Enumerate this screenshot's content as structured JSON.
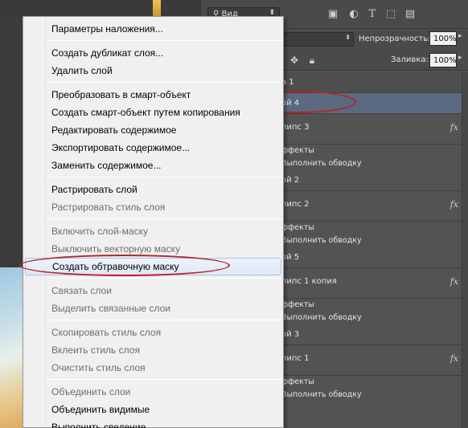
{
  "layers_panel": {
    "kind_filter": "Вид",
    "opacity_label": "Непрозрачность:",
    "opacity_value": "100%",
    "fill_label": "Заливка:",
    "fill_value": "100%",
    "rows": [
      {
        "kind": "group",
        "name": "а 1"
      },
      {
        "kind": "layer",
        "name": "ой 4",
        "selected": true
      },
      {
        "kind": "shape",
        "name": "липс 3",
        "fx": "fx"
      },
      {
        "kind": "effect",
        "name": "ффекты"
      },
      {
        "kind": "effect",
        "name": "Выполнить обводку"
      },
      {
        "kind": "layer",
        "name": "ой 2"
      },
      {
        "kind": "shape",
        "name": "липс 2",
        "fx": "fx"
      },
      {
        "kind": "effect",
        "name": "ффекты"
      },
      {
        "kind": "effect",
        "name": "Выполнить обводку"
      },
      {
        "kind": "layer",
        "name": "ой 5"
      },
      {
        "kind": "shape",
        "name": "липс 1 копия",
        "fx": "fx"
      },
      {
        "kind": "effect",
        "name": "ффекты"
      },
      {
        "kind": "effect",
        "name": "Выполнить обводку"
      },
      {
        "kind": "layer",
        "name": "ой 3"
      },
      {
        "kind": "shape",
        "name": "липс 1",
        "fx": "fx"
      },
      {
        "kind": "effect",
        "name": "ффекты"
      },
      {
        "kind": "effect",
        "name": "Выполнить обводку"
      }
    ],
    "filter_icons": [
      "image-filter-icon",
      "adjustment-filter-icon",
      "text-filter-icon",
      "shape-filter-icon",
      "smart-object-filter-icon"
    ],
    "lock_icons": [
      "move-lock-icon",
      "lock-icon"
    ]
  },
  "context_menu": {
    "items": [
      {
        "label": "Параметры наложения...",
        "enabled": true
      },
      {
        "sep": true
      },
      {
        "label": "Создать дубликат слоя...",
        "enabled": true
      },
      {
        "label": "Удалить слой",
        "enabled": true
      },
      {
        "sep": true
      },
      {
        "label": "Преобразовать в смарт-объект",
        "enabled": true
      },
      {
        "label": "Создать смарт-объект путем копирования",
        "enabled": true
      },
      {
        "label": "Редактировать содержимое",
        "enabled": true
      },
      {
        "label": "Экспортировать содержимое...",
        "enabled": true
      },
      {
        "label": "Заменить содержимое...",
        "enabled": true
      },
      {
        "sep": true
      },
      {
        "label": "Растрировать слой",
        "enabled": true
      },
      {
        "label": "Растрировать стиль слоя",
        "enabled": false
      },
      {
        "sep": true
      },
      {
        "label": "Включить слой-маску",
        "enabled": false
      },
      {
        "label": "Выключить векторную маску",
        "enabled": false
      },
      {
        "label": "Создать обтравочную маску",
        "enabled": true,
        "highlighted": true
      },
      {
        "sep": true
      },
      {
        "label": "Связать слои",
        "enabled": false
      },
      {
        "label": "Выделить связанные слои",
        "enabled": false
      },
      {
        "sep": true
      },
      {
        "label": "Скопировать стиль слоя",
        "enabled": false
      },
      {
        "label": "Вклеить стиль слоя",
        "enabled": false
      },
      {
        "label": "Очистить стиль слоя",
        "enabled": false
      },
      {
        "sep": true
      },
      {
        "label": "Объединить слои",
        "enabled": false
      },
      {
        "label": "Объединить видимые",
        "enabled": true
      },
      {
        "label": "Выполнить сведение",
        "enabled": true
      }
    ]
  },
  "colors": {
    "annotation": "#b5232a",
    "selected_layer": "#5b6a80",
    "menu_bg": "#f0f0f0",
    "panel_bg": "#535353"
  }
}
